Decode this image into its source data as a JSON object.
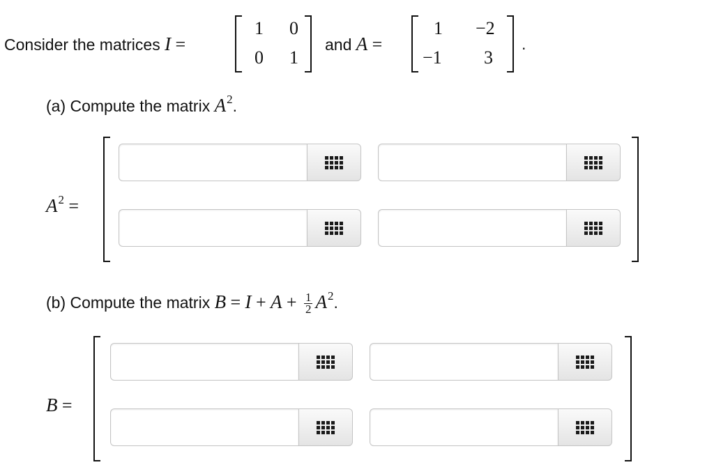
{
  "intro": {
    "text": "Consider the matrices",
    "and": "and",
    "period": ".",
    "I_symbol": "I",
    "A_symbol": "A",
    "equals": "=",
    "matrix_I": [
      [
        "1",
        "0"
      ],
      [
        "0",
        "1"
      ]
    ],
    "matrix_A": [
      [
        "1",
        "−2"
      ],
      [
        "−1",
        "3"
      ]
    ]
  },
  "part_a": {
    "label": "(a) Compute the matrix",
    "symbol": "A",
    "exponent": "2",
    "period": ".",
    "lhs_symbol": "A",
    "lhs_exponent": "2",
    "lhs_equals": "=",
    "inputs": [
      [
        "",
        ""
      ],
      [
        "",
        ""
      ]
    ]
  },
  "part_b": {
    "label": "(b) Compute the matrix",
    "B": "B",
    "equals": "=",
    "I": "I",
    "plus": "+",
    "A": "A",
    "frac_num": "1",
    "frac_den": "2",
    "A2_symbol": "A",
    "A2_exponent": "2",
    "period": ".",
    "lhs_symbol": "B",
    "lhs_equals": "=",
    "inputs": [
      [
        "",
        ""
      ],
      [
        "",
        ""
      ]
    ]
  },
  "icons": {
    "keypad": "keypad-grid-icon"
  }
}
